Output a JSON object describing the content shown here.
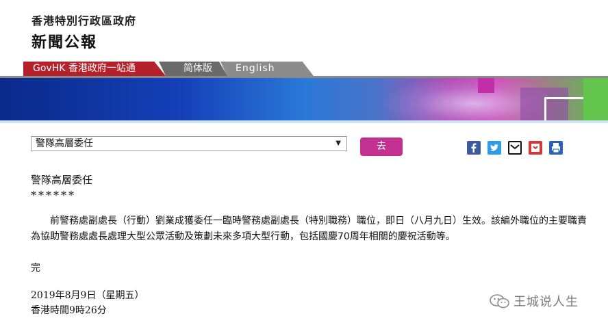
{
  "header": {
    "org_name": "香港特別行政區政府",
    "site_title": "新聞公報"
  },
  "tabs": {
    "govhk": "GovHK 香港政府一站通",
    "simplified": "简体版",
    "english": "English"
  },
  "controls": {
    "select_value": "警隊高層委任",
    "go_label": "去"
  },
  "share_icons": [
    "facebook-icon",
    "twitter-icon",
    "email-icon",
    "bookmark-icon",
    "print-icon"
  ],
  "article": {
    "heading": "警隊高層委任",
    "stars": "******",
    "paragraph": "前警務處副處長（行動）劉業成獲委任一臨時警務處副處長（特別職務）職位，即日（八月九日）生效。該編外職位的主要職責為協助警務處處長處理大型公眾活動及策劃未來多項大型行動，包括國慶70周年相關的慶祝活動等。",
    "end_mark": "完",
    "date": "2019年8月9日（星期五）",
    "time": "香港時間9時26分"
  },
  "watermark": {
    "text": "王城说人生"
  },
  "colors": {
    "govhk_tab": "#b5202b",
    "go_button": "#c2318f",
    "facebook": "#3b5c9c",
    "twitter": "#2f9de3"
  }
}
